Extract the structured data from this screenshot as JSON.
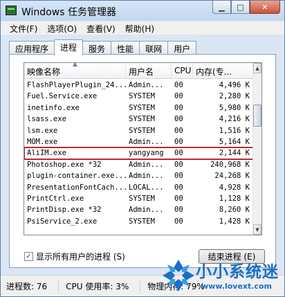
{
  "window": {
    "title": "Windows 任务管理器"
  },
  "caption": {
    "minimize": "▁",
    "maximize": "□",
    "close": "✕"
  },
  "menu": [
    "文件(F)",
    "选项(O)",
    "查看(V)",
    "帮助(H)"
  ],
  "tabs": [
    "应用程序",
    "进程",
    "服务",
    "性能",
    "联网",
    "用户"
  ],
  "active_tab": "进程",
  "table": {
    "columns": [
      "映像名称",
      "用户名",
      "CPU",
      "内存(专..."
    ],
    "rows": [
      [
        "FlashPlayerPlugin_24...",
        "Admin...",
        "00",
        "4,496 K"
      ],
      [
        "Fuel.Service.exe",
        "SYSTEM",
        "00",
        "2,280 K"
      ],
      [
        "inetinfo.exe",
        "SYSTEM",
        "00",
        "5,980 K"
      ],
      [
        "lsass.exe",
        "SYSTEM",
        "00",
        "4,216 K"
      ],
      [
        "lsm.exe",
        "SYSTEM",
        "00",
        "1,516 K"
      ],
      [
        "MOM.exe",
        "Admin...",
        "00",
        "5,164 K"
      ],
      [
        "AliIM.exe",
        "yangyang",
        "00",
        "2,144 K"
      ],
      [
        "Photoshop.exe *32",
        "Admin...",
        "00",
        "240,968 K"
      ],
      [
        "plugin-container.exe...",
        "Admin...",
        "00",
        "24,268 K"
      ],
      [
        "PresentationFontCach...",
        "LOCAL...",
        "00",
        "4,928 K"
      ],
      [
        "PrintCtrl.exe",
        "SYSTEM",
        "00",
        "1,128 K"
      ],
      [
        "PrintDisp.exe *32",
        "Admin...",
        "00",
        "8,260 K"
      ],
      [
        "PsiService_2.exe",
        "SYSTEM",
        "00",
        "1,428 K"
      ]
    ],
    "highlighted_row": 6
  },
  "show_all_label": "显示所有用户的进程 (S)",
  "show_all_checked": "✓",
  "end_process_label": "结束进程 (E)",
  "status": {
    "processes": "进程数: 76",
    "cpu": "CPU 使用率: 3%",
    "memory": "物理内存: 79%"
  },
  "watermark": {
    "text": "小小系统迷",
    "url": "www.lovext.com"
  },
  "colors": {
    "highlight": "#c0282d",
    "watermark": "#1b6fc4"
  }
}
